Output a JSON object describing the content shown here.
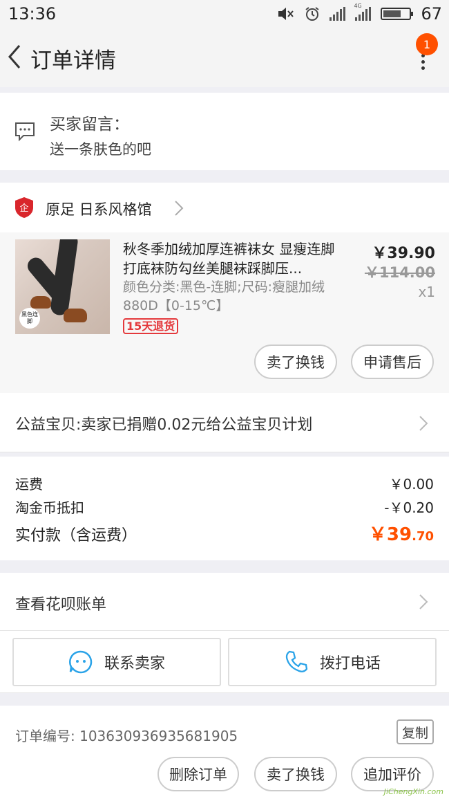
{
  "status_bar": {
    "time": "13:36",
    "battery": "67",
    "network_label": "4G"
  },
  "nav": {
    "title": "订单详情",
    "badge": "1"
  },
  "buyer_message": {
    "label": "买家留言：",
    "value": "送一条肤色的吧"
  },
  "shop": {
    "logo_text": "企",
    "name": "原足 日系风格馆"
  },
  "product": {
    "thumb_tag": "黑色连脚",
    "title": "秋冬季加绒加厚连裤袜女 显瘦连脚打底袜防勾丝美腿袜踩脚压...",
    "spec": "颜色分类:黑色-连脚;尺码:瘦腿加绒880D【0-15℃】",
    "return_badge": "15天退货",
    "price": "￥39.90",
    "original_price": "￥114.00",
    "quantity": "x1",
    "sell_button": "卖了换钱",
    "after_sale_button": "申请售后"
  },
  "charity": {
    "text": "公益宝贝:卖家已捐赠0.02元给公益宝贝计划"
  },
  "fees": {
    "shipping_label": "运费",
    "shipping_value": "￥0.00",
    "coin_label": "淘金币抵扣",
    "coin_value": "-￥0.20",
    "paid_label": "实付款（含运费）",
    "paid_symbol": "￥",
    "paid_int": "39",
    "paid_dec": ".70"
  },
  "huabei": {
    "text": "查看花呗账单"
  },
  "contact": {
    "seller": "联系卖家",
    "phone": "拨打电话"
  },
  "order": {
    "number": "订单编号: 103630936935681905",
    "copy": "复制",
    "delete": "删除订单",
    "sell": "卖了换钱",
    "review": "追加评价"
  },
  "watermark": "JiChengXin.com",
  "colors": {
    "accent": "#ff5000",
    "blue_icon": "#2aa3e8",
    "return_red": "#e4393c"
  }
}
